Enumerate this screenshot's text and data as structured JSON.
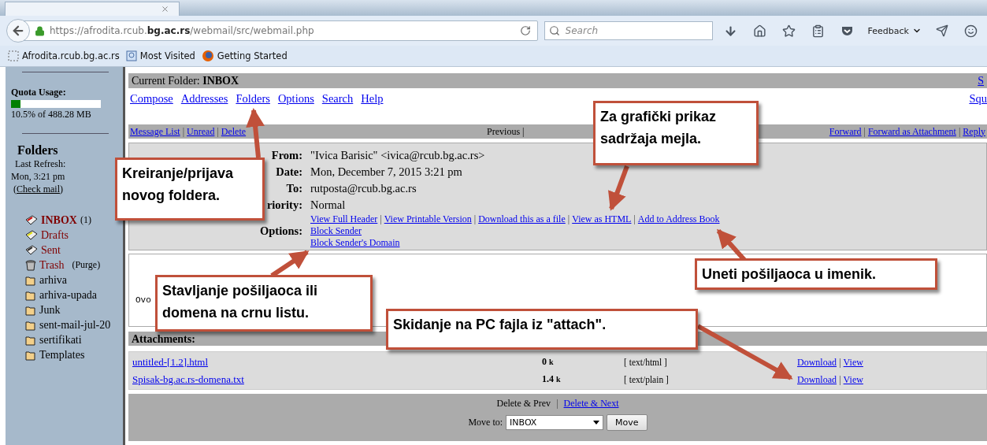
{
  "browser": {
    "url": "https://afrodita.rcub.**bg.ac.rs**/webmail/src/webmail.php",
    "search": {
      "placeholder": "Search"
    },
    "feedback": "Feedback",
    "bookmarks": [
      {
        "label": "Afrodita.rcub.bg.ac.rs",
        "kind": "page"
      },
      {
        "label": "Most Visited",
        "kind": "visited"
      },
      {
        "label": "Getting Started",
        "kind": "firefox"
      }
    ]
  },
  "sidebar": {
    "quota_title": "Quota Usage:",
    "quota": {
      "level": 0.105
    },
    "quota_text": "10.5% of 488.28 MB",
    "folders_title": "Folders",
    "last_refresh": "Last Refresh:",
    "refresh_time": "Mon, 3:21 pm",
    "check_open": "(",
    "check_mail": "Check mail",
    "check_close": ")",
    "folders": [
      {
        "name": "INBOX",
        "kind": "inbox",
        "special": true,
        "count": "(1)"
      },
      {
        "name": "Drafts",
        "kind": "drafts",
        "special": true
      },
      {
        "name": "Sent",
        "kind": "sent",
        "special": true
      },
      {
        "name": "Trash",
        "kind": "trash",
        "special": true,
        "extra": "(Purge)"
      },
      {
        "name": "arhiva",
        "kind": "folder",
        "special": false
      },
      {
        "name": "arhiva-upada",
        "kind": "folder",
        "special": false
      },
      {
        "name": "Junk",
        "kind": "folder",
        "special": false
      },
      {
        "name": "sent-mail-jul-20",
        "kind": "folder",
        "special": false
      },
      {
        "name": "sertifikati",
        "kind": "folder",
        "special": false
      },
      {
        "name": "Templates",
        "kind": "folder",
        "special": false
      }
    ]
  },
  "current_folder": {
    "label": "Current Folder:",
    "name": "INBOX",
    "right": "S"
  },
  "menu": [
    "Compose",
    "Addresses",
    "Folders",
    "Options",
    "Search",
    "Help"
  ],
  "menu_right": "Squ",
  "message_bar": {
    "left": [
      "Message List",
      "Unread",
      "Delete"
    ],
    "middle": "Previous |",
    "right": [
      "Forward",
      "Forward as Attachment",
      "Reply"
    ]
  },
  "headers": [
    {
      "label": "From:",
      "value": "\"Ivica Barisic\" <ivica@rcub.bg.ac.rs>"
    },
    {
      "label": "Date:",
      "value": "Mon, December 7, 2015 3:21 pm"
    },
    {
      "label": "To:",
      "value": "rutposta@rcub.bg.ac.rs"
    },
    {
      "label": "riority:",
      "value": "Normal"
    }
  ],
  "options_label": "Options:",
  "options": [
    [
      "View Full Header",
      "View Printable Version",
      "Download this as a file",
      "View as HTML",
      "Add to Address Book"
    ],
    [
      "Block Sender"
    ],
    [
      "Block Sender's Domain"
    ]
  ],
  "body_text": "Ovo",
  "separator": "|",
  "attachments": {
    "title": "Attachments:",
    "rows": [
      {
        "name": "untitled-[1.2].html",
        "size": "0",
        "unit": "k",
        "type": "[ text/html ]",
        "actions": [
          "Download",
          "View"
        ]
      },
      {
        "name": "Spisak-bg.ac.rs-domena.txt",
        "size": "1.4",
        "unit": "k",
        "type": "[ text/plain ]",
        "actions": [
          "Download",
          "View"
        ]
      }
    ]
  },
  "footer": {
    "delete_prev": "Delete & Prev",
    "delete_next": "Delete & Next",
    "move_label": "Move to:",
    "move_value": "INBOX",
    "move_button": "Move"
  },
  "annotations": [
    {
      "lines": [
        "Kreiranje/prijava",
        "novog foldera."
      ]
    },
    {
      "lines": [
        "Za grafički prikaz",
        "sadržaja mejla."
      ]
    },
    {
      "lines": [
        "Uneti pošiljaoca u imenik."
      ]
    },
    {
      "lines": [
        "Stavljanje pošiljaoca ili",
        "domena na crnu listu."
      ]
    },
    {
      "lines": [
        "Skidanje na PC fajla iz \"attach\"."
      ]
    }
  ]
}
